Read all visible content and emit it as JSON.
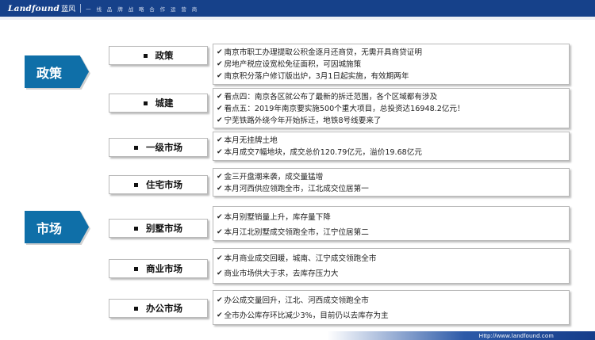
{
  "header": {
    "logo_en": "Landfound",
    "logo_cn": "蓝风",
    "slogan": "一 线 品 牌 战 略 合 作 运 营 商"
  },
  "categories": [
    {
      "label": "政策"
    },
    {
      "label": "市场"
    }
  ],
  "items": [
    {
      "label": "政策",
      "lines": [
        "南京市职工办理提取公积金逐月还商贷，无需开具商贷证明",
        "房地产税应设宽松免征面积，可因城施策",
        "南京积分落户修订版出炉，3月1日起实施，有效期两年"
      ]
    },
    {
      "label": "城建",
      "lines": [
        "看点四：南京各区就公布了最新的拆迁范围，各个区域都有涉及",
        "看点五：2019年南京要实施500个重大项目，总投资达16948.2亿元！",
        "宁芜铁路外绕今年开始拆迁，地铁8号线要来了"
      ]
    },
    {
      "label": "一级市场",
      "lines": [
        "本月无挂牌土地",
        "本月成交7幅地块，成交总价120.79亿元，溢价19.68亿元"
      ]
    },
    {
      "label": "住宅市场",
      "lines": [
        "金三开盘潮来袭，成交量猛增",
        "本月河西供应领跑全市，江北成交位居第一"
      ]
    },
    {
      "label": "别墅市场",
      "lines": [
        "本月别墅销量上升，库存量下降",
        "本月江北别墅成交领跑全市，江宁位居第二"
      ]
    },
    {
      "label": "商业市场",
      "lines": [
        "本月商业成交回暖，城南、江宁成交领跑全市",
        "商业市场供大于求，去库存压力大"
      ]
    },
    {
      "label": "办公市场",
      "lines": [
        "办公成交量回升，江北、河西成交领跑全市",
        "全市办公库存环比减少3%，目前仍以去库存为主"
      ]
    }
  ],
  "footer": {
    "url": "Http://www.landfound.com"
  }
}
